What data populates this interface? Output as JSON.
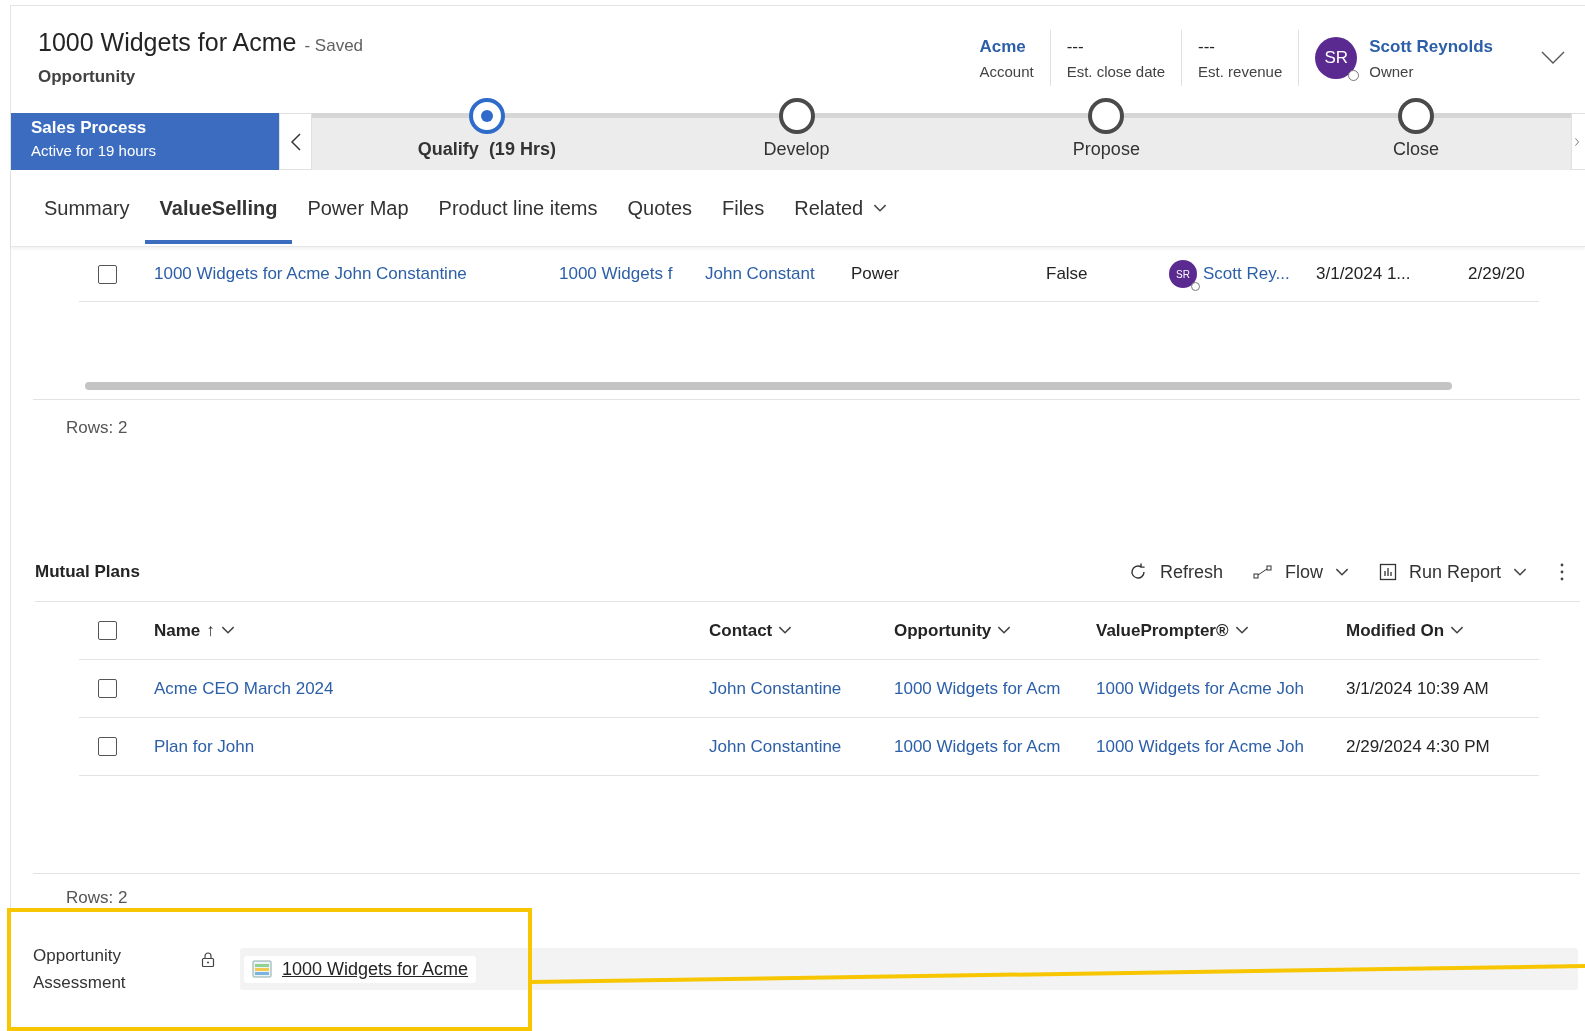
{
  "header": {
    "title": "1000 Widgets for Acme",
    "save_status": "- Saved",
    "entity": "Opportunity",
    "fields": [
      {
        "value": "Acme",
        "label": "Account",
        "kind": "link"
      },
      {
        "value": "---",
        "label": "Est. close date",
        "kind": "text"
      },
      {
        "value": "---",
        "label": "Est. revenue",
        "kind": "text"
      }
    ],
    "owner": {
      "initials": "SR",
      "name": "Scott Reynolds",
      "label": "Owner"
    }
  },
  "process": {
    "name": "Sales Process",
    "duration": "Active for 19 hours",
    "stages": [
      {
        "label": "Qualify",
        "time": "(19 Hrs)",
        "selected": true
      },
      {
        "label": "Develop",
        "selected": false
      },
      {
        "label": "Propose",
        "selected": false
      },
      {
        "label": "Close",
        "selected": false
      }
    ]
  },
  "tabs": [
    {
      "label": "Summary",
      "selected": false,
      "kind": "tab"
    },
    {
      "label": "ValueSelling",
      "selected": true,
      "kind": "tab"
    },
    {
      "label": "Power Map",
      "selected": false,
      "kind": "tab"
    },
    {
      "label": "Product line items",
      "selected": false,
      "kind": "tab"
    },
    {
      "label": "Quotes",
      "selected": false,
      "kind": "tab"
    },
    {
      "label": "Files",
      "selected": false,
      "kind": "tab"
    },
    {
      "label": "Related",
      "selected": false,
      "kind": "menu"
    }
  ],
  "upper_grid": {
    "rows": [
      {
        "checked": false,
        "cells": [
          {
            "kind": "link",
            "text": "1000 Widgets for Acme John Constantine"
          },
          {
            "kind": "link",
            "text": "1000 Widgets f"
          },
          {
            "kind": "link",
            "text": "John Constant"
          },
          {
            "kind": "text",
            "text": "Power"
          },
          {
            "kind": "text",
            "text": "False"
          },
          {
            "kind": "person",
            "initials": "SR",
            "text": "Scott Rey..."
          },
          {
            "kind": "text",
            "text": "3/1/2024 1..."
          },
          {
            "kind": "text",
            "text": "2/29/20"
          }
        ]
      }
    ],
    "footer": "Rows: 2"
  },
  "mutual_plans": {
    "title": "Mutual Plans",
    "commands": [
      {
        "label": "Refresh",
        "kind": "refresh"
      },
      {
        "label": "Flow",
        "kind": "flow"
      },
      {
        "label": "Run Report",
        "kind": "report"
      },
      {
        "kind": "more"
      }
    ],
    "all_checked": false,
    "columns": [
      {
        "label": "Name",
        "sort_mark": "↑"
      },
      {
        "label": "Contact"
      },
      {
        "label": "Opportunity"
      },
      {
        "label": "ValuePrompter®"
      },
      {
        "label": "Modified On"
      }
    ],
    "rows": [
      {
        "checked": false,
        "cells": [
          {
            "kind": "link",
            "text": "Acme CEO March 2024"
          },
          {
            "kind": "link",
            "text": "John Constantine"
          },
          {
            "kind": "link",
            "text": "1000 Widgets for Acm"
          },
          {
            "kind": "link",
            "text": "1000 Widgets for Acme Joh"
          },
          {
            "kind": "text",
            "text": "3/1/2024 10:39 AM"
          }
        ]
      },
      {
        "checked": false,
        "cells": [
          {
            "kind": "link",
            "text": "Plan for John"
          },
          {
            "kind": "link",
            "text": "John Constantine"
          },
          {
            "kind": "link",
            "text": "1000 Widgets for Acm"
          },
          {
            "kind": "link",
            "text": "1000 Widgets for Acme Joh"
          },
          {
            "kind": "text",
            "text": "2/29/2024 4:30 PM"
          }
        ]
      }
    ],
    "footer": "Rows: 2"
  },
  "assessment": {
    "label": "Opportunity Assessment",
    "locked": true,
    "value": "1000 Widgets for Acme"
  }
}
